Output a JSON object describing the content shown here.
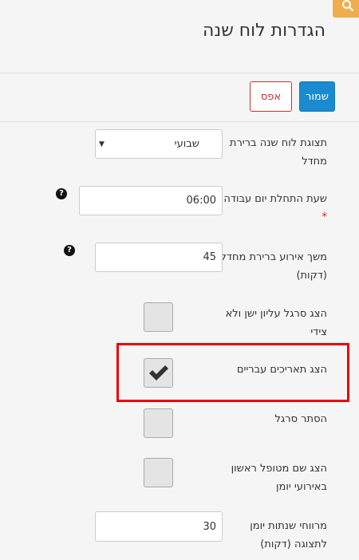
{
  "header": {
    "title": "הגדרות לוח שנה",
    "search_icon": "search-icon",
    "accent_color": "#f0ad4e"
  },
  "toolbar": {
    "save_label": "שמור",
    "reset_label": "אפס"
  },
  "settings": [
    {
      "label": "תצוגת לוח שנה ברירת מחדל",
      "type": "select",
      "value": "שבועי"
    },
    {
      "label": "שעת התחלת יום עבודה",
      "required": "*",
      "type": "input",
      "value": "06:00",
      "help": "?"
    },
    {
      "label": "משך אירוע ברירת מחדל (דקות)",
      "type": "input",
      "value": "45",
      "help": "?"
    },
    {
      "label": "הצג סרגל עליון ישן ולא צידי",
      "type": "checkbox",
      "checked": false
    },
    {
      "label": "הצג תאריכים עבריים",
      "type": "checkbox",
      "checked": true,
      "highlighted": true
    },
    {
      "label": "הסתר סרגל",
      "type": "checkbox",
      "checked": false
    },
    {
      "label": "הצג שם מטופל ראשון באירועי יומן",
      "type": "checkbox",
      "checked": false
    },
    {
      "label": "מרווחי שנתות יומן לתצוגה (דקות)",
      "type": "input",
      "value": "30"
    }
  ]
}
